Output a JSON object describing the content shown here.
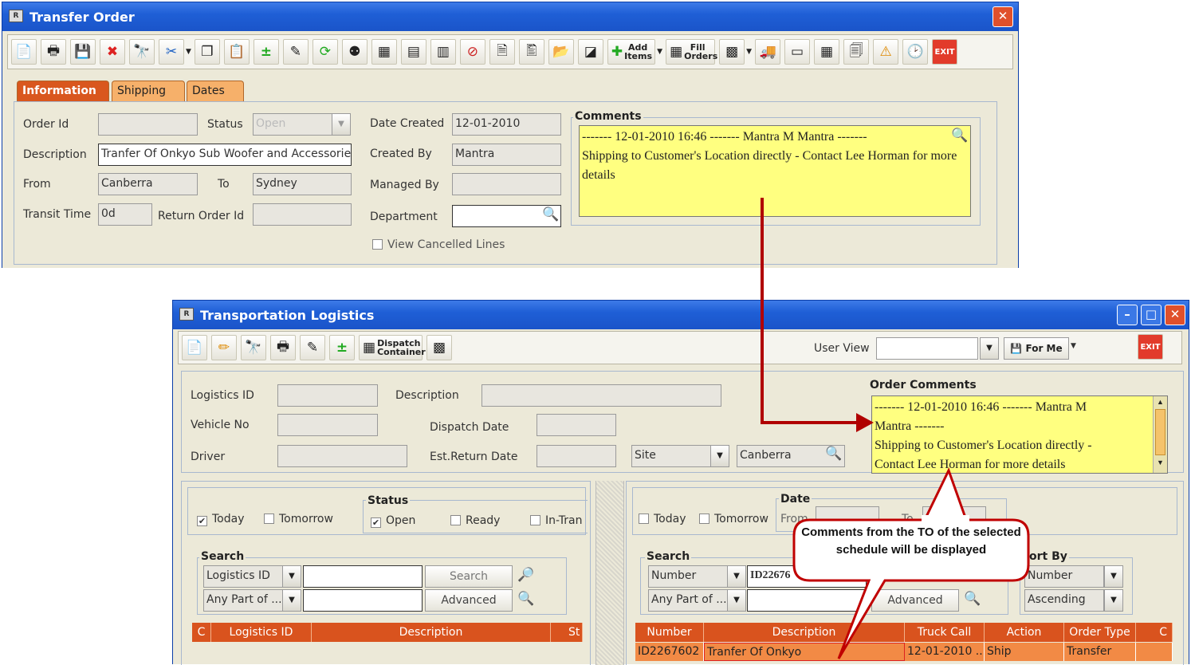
{
  "transfer_order": {
    "title": "Transfer Order",
    "toolbar_text": {
      "add_items": "Add Items",
      "fill_orders": "Fill Orders"
    },
    "tabs": [
      "Information",
      "Shipping",
      "Dates"
    ],
    "labels": {
      "order_id": "Order Id",
      "status": "Status",
      "description": "Description",
      "from": "From",
      "to": "To",
      "transit_time": "Transit Time",
      "return_order_id": "Return Order Id",
      "date_created": "Date Created",
      "created_by": "Created By",
      "managed_by": "Managed By",
      "department": "Department",
      "view_cancelled": "View Cancelled Lines",
      "comments": "Comments"
    },
    "values": {
      "order_id": "",
      "status": "Open",
      "description": "Tranfer Of Onkyo Sub Woofer and Accessories",
      "from": "Canberra",
      "to": "Sydney",
      "transit_time": "0d",
      "return_order_id": "",
      "date_created": "12-01-2010",
      "created_by": "Mantra",
      "managed_by": "",
      "department": ""
    },
    "comment_header": "------- 12-01-2010 16:46 ------- Mantra M Mantra -------",
    "comment_body": "Shipping to Customer's Location directly - Contact Lee Horman for more details"
  },
  "logistics": {
    "title": "Transportation Logistics",
    "toolbar_text": {
      "dispatch": "Dispatch Container",
      "user_view": "User View",
      "for_me": "For Me"
    },
    "labels": {
      "logistics_id": "Logistics ID",
      "description": "Description",
      "vehicle_no": "Vehicle No",
      "dispatch_date": "Dispatch Date",
      "driver": "Driver",
      "est_return": "Est.Return Date",
      "order_comments": "Order Comments"
    },
    "site_select": "Site",
    "site_value": "Canberra",
    "comment_lines": [
      "------- 12-01-2010 16:46 ------- Mantra M",
      "Mantra -------",
      "Shipping to Customer's Location directly -",
      "Contact Lee Horman for more details"
    ],
    "left": {
      "today": "Today",
      "tomorrow": "Tomorrow",
      "status": "Status",
      "open": "Open",
      "ready": "Ready",
      "in_transit": "In-Tran",
      "search": "Search",
      "search_by": "Logistics ID",
      "match": "Any Part of ...",
      "search_btn": "Search",
      "advanced_btn": "Advanced",
      "columns": [
        "C",
        "Logistics ID",
        "Description",
        "St"
      ]
    },
    "right": {
      "today": "Today",
      "tomorrow": "Tomorrow",
      "date": "Date",
      "from": "From",
      "to": "To",
      "search": "Search",
      "search_by": "Number",
      "search_value": "ID22676",
      "match": "Any Part of ...",
      "advanced_btn": "Advanced",
      "sort_by": "ort By",
      "sort_field": "Number",
      "sort_order": "Ascending",
      "columns": [
        "Number",
        "Description",
        "Truck Call",
        "Action",
        "Order Type",
        "C"
      ],
      "row": [
        "ID2267602",
        "Tranfer Of Onkyo",
        "12-01-2010 ...",
        "Ship",
        "Transfer"
      ]
    }
  },
  "callout": "Comments from the TO of the selected schedule will be displayed",
  "colors": {
    "titlebar": "#1f5fd6",
    "tab_active": "#d9571e",
    "comment_bg": "#ffff80",
    "arrow": "#c00000"
  }
}
